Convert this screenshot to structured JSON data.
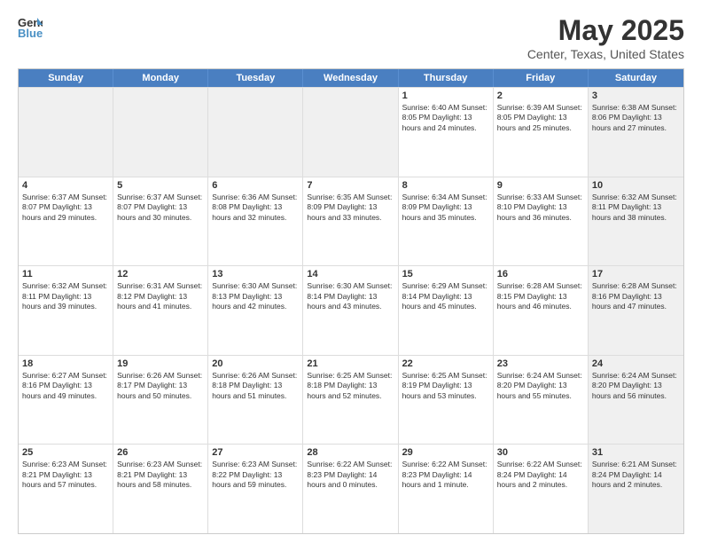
{
  "logo": {
    "general": "General",
    "blue": "Blue"
  },
  "title": {
    "month_year": "May 2025",
    "location": "Center, Texas, United States"
  },
  "header_days": [
    "Sunday",
    "Monday",
    "Tuesday",
    "Wednesday",
    "Thursday",
    "Friday",
    "Saturday"
  ],
  "rows": [
    [
      {
        "day": "",
        "info": "",
        "shaded": true
      },
      {
        "day": "",
        "info": "",
        "shaded": true
      },
      {
        "day": "",
        "info": "",
        "shaded": true
      },
      {
        "day": "",
        "info": "",
        "shaded": true
      },
      {
        "day": "1",
        "info": "Sunrise: 6:40 AM\nSunset: 8:05 PM\nDaylight: 13 hours and 24 minutes."
      },
      {
        "day": "2",
        "info": "Sunrise: 6:39 AM\nSunset: 8:05 PM\nDaylight: 13 hours and 25 minutes."
      },
      {
        "day": "3",
        "info": "Sunrise: 6:38 AM\nSunset: 8:06 PM\nDaylight: 13 hours and 27 minutes.",
        "shaded": true
      }
    ],
    [
      {
        "day": "4",
        "info": "Sunrise: 6:37 AM\nSunset: 8:07 PM\nDaylight: 13 hours and 29 minutes."
      },
      {
        "day": "5",
        "info": "Sunrise: 6:37 AM\nSunset: 8:07 PM\nDaylight: 13 hours and 30 minutes."
      },
      {
        "day": "6",
        "info": "Sunrise: 6:36 AM\nSunset: 8:08 PM\nDaylight: 13 hours and 32 minutes."
      },
      {
        "day": "7",
        "info": "Sunrise: 6:35 AM\nSunset: 8:09 PM\nDaylight: 13 hours and 33 minutes."
      },
      {
        "day": "8",
        "info": "Sunrise: 6:34 AM\nSunset: 8:09 PM\nDaylight: 13 hours and 35 minutes."
      },
      {
        "day": "9",
        "info": "Sunrise: 6:33 AM\nSunset: 8:10 PM\nDaylight: 13 hours and 36 minutes."
      },
      {
        "day": "10",
        "info": "Sunrise: 6:32 AM\nSunset: 8:11 PM\nDaylight: 13 hours and 38 minutes.",
        "shaded": true
      }
    ],
    [
      {
        "day": "11",
        "info": "Sunrise: 6:32 AM\nSunset: 8:11 PM\nDaylight: 13 hours and 39 minutes."
      },
      {
        "day": "12",
        "info": "Sunrise: 6:31 AM\nSunset: 8:12 PM\nDaylight: 13 hours and 41 minutes."
      },
      {
        "day": "13",
        "info": "Sunrise: 6:30 AM\nSunset: 8:13 PM\nDaylight: 13 hours and 42 minutes."
      },
      {
        "day": "14",
        "info": "Sunrise: 6:30 AM\nSunset: 8:14 PM\nDaylight: 13 hours and 43 minutes."
      },
      {
        "day": "15",
        "info": "Sunrise: 6:29 AM\nSunset: 8:14 PM\nDaylight: 13 hours and 45 minutes."
      },
      {
        "day": "16",
        "info": "Sunrise: 6:28 AM\nSunset: 8:15 PM\nDaylight: 13 hours and 46 minutes."
      },
      {
        "day": "17",
        "info": "Sunrise: 6:28 AM\nSunset: 8:16 PM\nDaylight: 13 hours and 47 minutes.",
        "shaded": true
      }
    ],
    [
      {
        "day": "18",
        "info": "Sunrise: 6:27 AM\nSunset: 8:16 PM\nDaylight: 13 hours and 49 minutes."
      },
      {
        "day": "19",
        "info": "Sunrise: 6:26 AM\nSunset: 8:17 PM\nDaylight: 13 hours and 50 minutes."
      },
      {
        "day": "20",
        "info": "Sunrise: 6:26 AM\nSunset: 8:18 PM\nDaylight: 13 hours and 51 minutes."
      },
      {
        "day": "21",
        "info": "Sunrise: 6:25 AM\nSunset: 8:18 PM\nDaylight: 13 hours and 52 minutes."
      },
      {
        "day": "22",
        "info": "Sunrise: 6:25 AM\nSunset: 8:19 PM\nDaylight: 13 hours and 53 minutes."
      },
      {
        "day": "23",
        "info": "Sunrise: 6:24 AM\nSunset: 8:20 PM\nDaylight: 13 hours and 55 minutes."
      },
      {
        "day": "24",
        "info": "Sunrise: 6:24 AM\nSunset: 8:20 PM\nDaylight: 13 hours and 56 minutes.",
        "shaded": true
      }
    ],
    [
      {
        "day": "25",
        "info": "Sunrise: 6:23 AM\nSunset: 8:21 PM\nDaylight: 13 hours and 57 minutes."
      },
      {
        "day": "26",
        "info": "Sunrise: 6:23 AM\nSunset: 8:21 PM\nDaylight: 13 hours and 58 minutes."
      },
      {
        "day": "27",
        "info": "Sunrise: 6:23 AM\nSunset: 8:22 PM\nDaylight: 13 hours and 59 minutes."
      },
      {
        "day": "28",
        "info": "Sunrise: 6:22 AM\nSunset: 8:23 PM\nDaylight: 14 hours and 0 minutes."
      },
      {
        "day": "29",
        "info": "Sunrise: 6:22 AM\nSunset: 8:23 PM\nDaylight: 14 hours and 1 minute."
      },
      {
        "day": "30",
        "info": "Sunrise: 6:22 AM\nSunset: 8:24 PM\nDaylight: 14 hours and 2 minutes."
      },
      {
        "day": "31",
        "info": "Sunrise: 6:21 AM\nSunset: 8:24 PM\nDaylight: 14 hours and 2 minutes.",
        "shaded": true
      }
    ]
  ]
}
